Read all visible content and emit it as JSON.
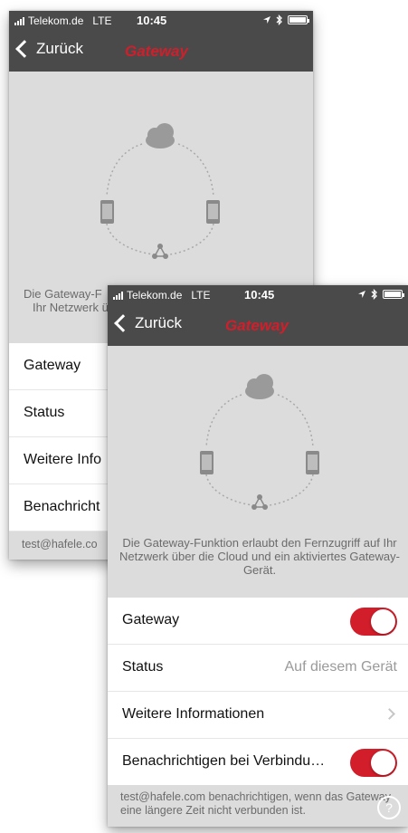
{
  "status_bar": {
    "carrier": "Telekom.de",
    "network": "LTE",
    "time": "10:45",
    "icons": [
      "signal-icon",
      "location-arrow-icon",
      "bluetooth-icon",
      "battery-icon"
    ]
  },
  "nav": {
    "back_label": "Zurück",
    "title": "Gateway"
  },
  "description": "Die Gateway-Funktion erlaubt den Fernzugriff auf Ihr Netzwerk über die Cloud und ein aktiviertes Gateway-Gerät.",
  "back_phone": {
    "caption_line1": "Die Gateway-F",
    "caption_line2": "Ihr Netzwerk ü",
    "rows": [
      "Gateway",
      "Status",
      "Weitere Info",
      "Benachricht"
    ],
    "footer": "test@hafele.co"
  },
  "settings": {
    "gateway_label": "Gateway",
    "gateway_enabled": true,
    "status_label": "Status",
    "status_value": "Auf diesem Gerät",
    "more_info_label": "Weitere Informationen",
    "notify_label": "Benachrichtigen bei Verbindu…",
    "notify_enabled": true
  },
  "footer_text": "test@hafele.com benachrichtigen, wenn das Gateway eine längere Zeit nicht verbunden ist.",
  "colors": {
    "accent": "#d21e2b",
    "bar": "#4a4a4a",
    "hero_bg": "#dcdcdc"
  }
}
